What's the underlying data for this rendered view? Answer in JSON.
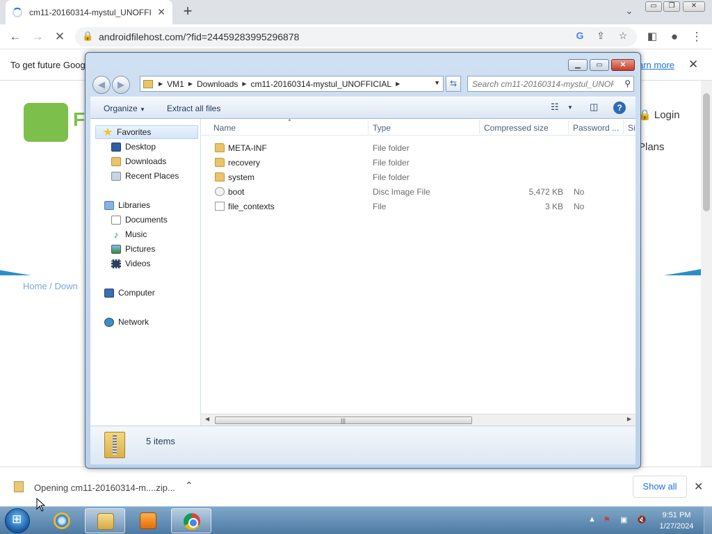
{
  "browser": {
    "tab_title": "cm11-20160314-mystul_UNOFFI",
    "url": "androidfilehost.com/?fid=24459283995296878",
    "infobar_message": "To get future Goog",
    "infobar_link": "arn more",
    "site": {
      "logo_letter": "F",
      "logo_sub": "F",
      "login": "Login",
      "plans": "Plans",
      "breadcrumb": "Home / Down"
    }
  },
  "explorer": {
    "address_segments": [
      "VM1",
      "Downloads",
      "cm11-20160314-mystul_UNOFFICIAL"
    ],
    "search_placeholder": "Search cm11-20160314-mystul_UNOF...",
    "commands": {
      "organize": "Organize",
      "extract": "Extract all files"
    },
    "nav": {
      "favorites": "Favorites",
      "desktop": "Desktop",
      "downloads": "Downloads",
      "recent": "Recent Places",
      "libraries": "Libraries",
      "documents": "Documents",
      "music": "Music",
      "pictures": "Pictures",
      "videos": "Videos",
      "computer": "Computer",
      "network": "Network"
    },
    "columns": [
      "Name",
      "Type",
      "Compressed size",
      "Password ...",
      "Si"
    ],
    "files": [
      {
        "name": "META-INF",
        "type": "File folder",
        "size": "",
        "password": "",
        "icon": "folder-icon"
      },
      {
        "name": "recovery",
        "type": "File folder",
        "size": "",
        "password": "",
        "icon": "folder-icon"
      },
      {
        "name": "system",
        "type": "File folder",
        "size": "",
        "password": "",
        "icon": "folder-icon"
      },
      {
        "name": "boot",
        "type": "Disc Image File",
        "size": "5,472 KB",
        "password": "No",
        "icon": "disc-image-icon"
      },
      {
        "name": "file_contexts",
        "type": "File",
        "size": "3 KB",
        "password": "No",
        "icon": "file-icon"
      }
    ],
    "status": "5 items"
  },
  "downloads": {
    "item": "Opening cm11-20160314-m....zip...",
    "show_all": "Show all"
  },
  "taskbar": {
    "time": "9:51 PM",
    "date": "1/27/2024"
  }
}
